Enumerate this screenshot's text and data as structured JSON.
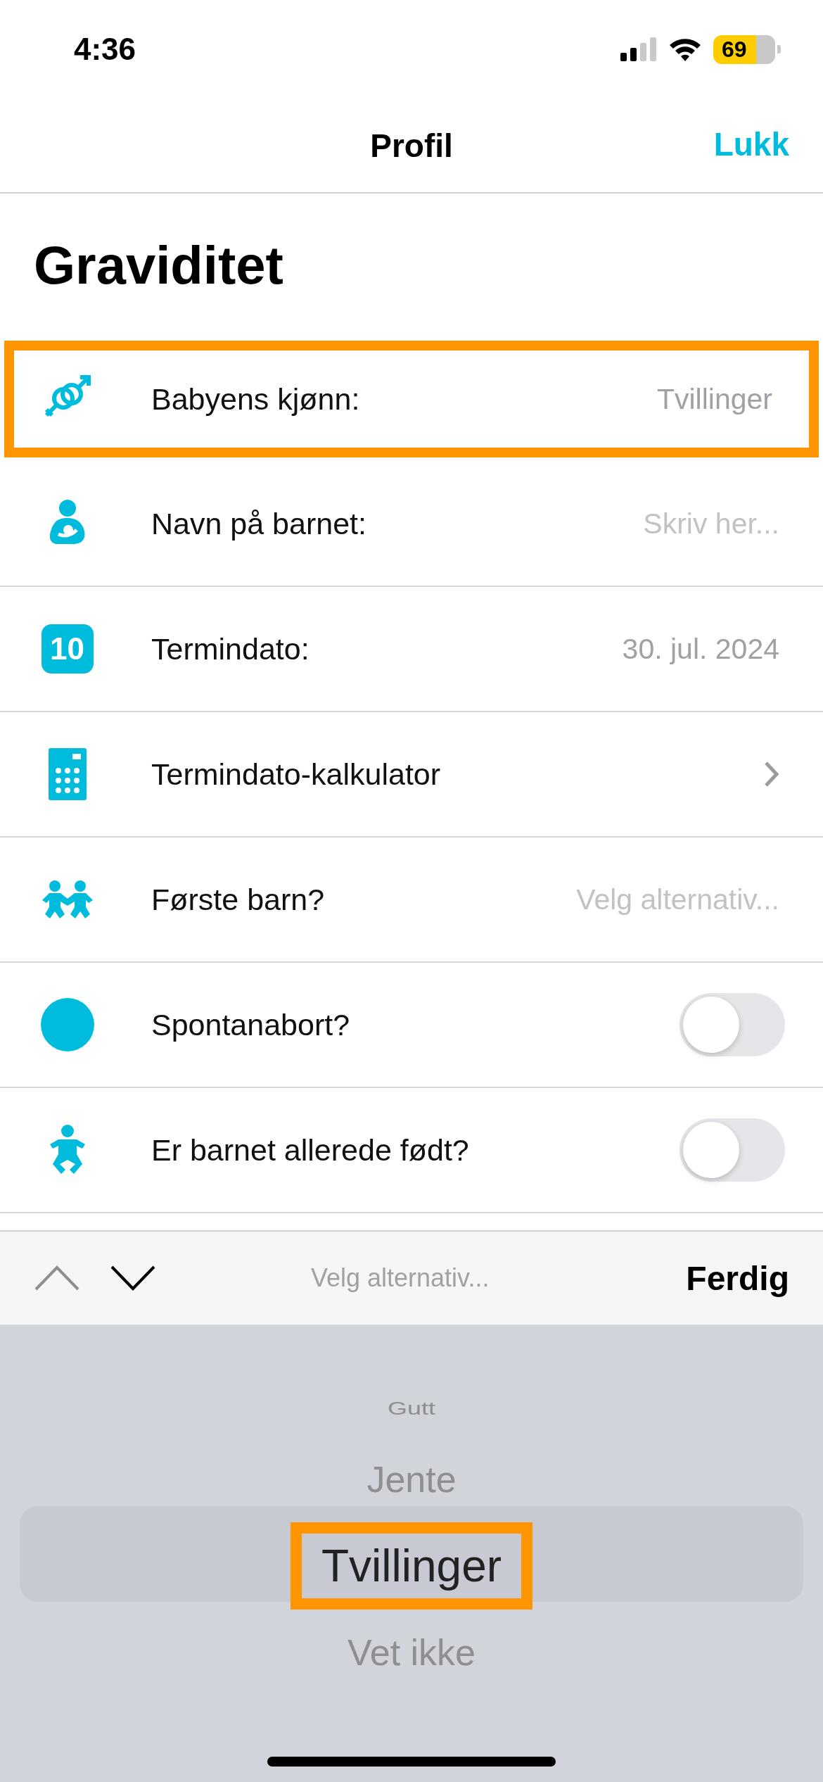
{
  "status_bar": {
    "time": "4:36",
    "battery": "69"
  },
  "nav": {
    "title": "Profil",
    "close": "Lukk"
  },
  "heading": "Graviditet",
  "rows": [
    {
      "kind": "value",
      "label": "Babyens kjønn:",
      "value": "Tvillinger",
      "highlighted": true
    },
    {
      "kind": "placeholder",
      "label": "Navn på barnet:",
      "placeholder": "Skriv her...",
      "highlighted": false
    },
    {
      "kind": "value",
      "icon_text": "10",
      "label": "Termindato:",
      "value": "30. jul. 2024",
      "highlighted": false
    },
    {
      "kind": "chevron",
      "label": "Termindato-kalkulator",
      "highlighted": false
    },
    {
      "kind": "placeholder",
      "label": "Første barn?",
      "placeholder": "Velg alternativ...",
      "highlighted": false
    },
    {
      "kind": "toggle",
      "label": "Spontanabort?",
      "on": false,
      "highlighted": false
    },
    {
      "kind": "toggle",
      "label": "Er barnet allerede født?",
      "on": false,
      "highlighted": false
    }
  ],
  "toolbar": {
    "prev_disabled": true,
    "next_disabled": false,
    "prompt": "Velg alternativ...",
    "done": "Ferdig"
  },
  "picker": {
    "options": [
      {
        "label": "Gutt",
        "selected": false,
        "highlighted": false
      },
      {
        "label": "Jente",
        "selected": false,
        "highlighted": false
      },
      {
        "label": "Tvillinger",
        "selected": true,
        "highlighted": true
      },
      {
        "label": "Vet ikke",
        "selected": false,
        "highlighted": false
      }
    ]
  }
}
